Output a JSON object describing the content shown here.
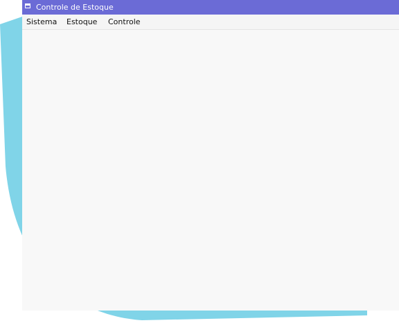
{
  "window": {
    "title": "Controle de Estoque",
    "icon": "app-window-icon",
    "title_bar_color": "#6b6bd6"
  },
  "menubar": {
    "items": [
      {
        "label": "Sistema"
      },
      {
        "label": "Estoque"
      },
      {
        "label": "Controle"
      }
    ]
  },
  "colors": {
    "client_background": "#f8f8f8",
    "decoration": "#80d4e8"
  }
}
